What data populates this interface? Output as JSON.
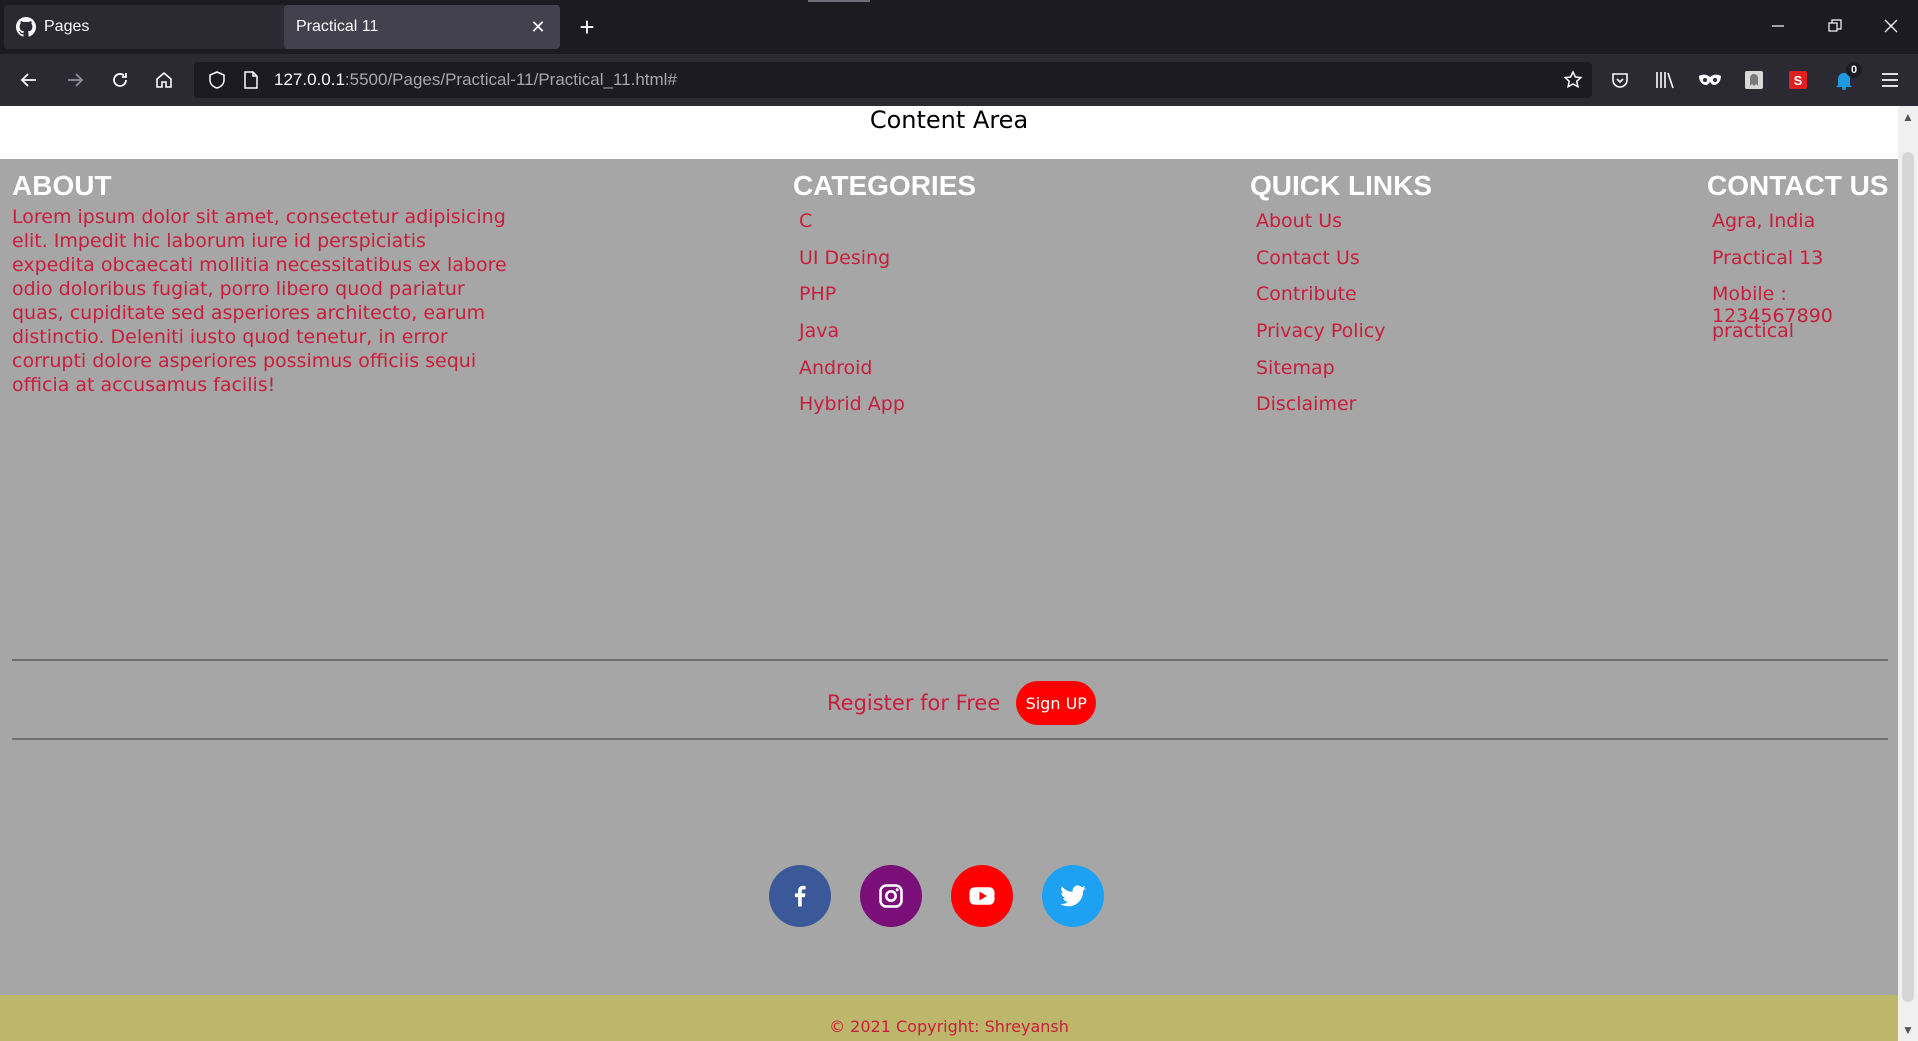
{
  "browser": {
    "tabs": [
      {
        "title": "Pages",
        "icon": "github-icon",
        "active": false
      },
      {
        "title": "Practical 11",
        "icon": "",
        "active": true
      }
    ],
    "url_host": "127.0.0.1",
    "url_rest": ":5500/Pages/Practical-11/Practical_11.html#",
    "extension_badge": "0"
  },
  "page": {
    "content_area_title": "Content Area",
    "about": {
      "heading": "ABOUT",
      "text": "Lorem ipsum dolor sit amet, consectetur adipisicing elit. Impedit hic laborum iure id perspiciatis expedita obcaecati mollitia necessitatibus ex labore odio doloribus fugiat, porro libero quod pariatur quas, cupiditate sed asperiores architecto, earum distinctio. Deleniti iusto quod tenetur, in error corrupti dolore asperiores possimus officiis sequi officia at accusamus facilis!"
    },
    "categories": {
      "heading": "CATEGORIES",
      "items": [
        "C",
        "UI Desing",
        "PHP",
        "Java",
        "Android",
        "Hybrid App"
      ]
    },
    "quick_links": {
      "heading": "QUICK LINKS",
      "items": [
        "About Us",
        "Contact Us",
        "Contribute",
        "Privacy Policy",
        "Sitemap",
        "Disclaimer"
      ]
    },
    "contact": {
      "heading": "CONTACT US",
      "items": [
        "Agra, India",
        "Practical 13",
        "Mobile : 1234567890",
        "practical"
      ]
    },
    "register": {
      "text": "Register for Free",
      "button": "Sign UP"
    },
    "social": [
      {
        "name": "facebook-icon",
        "color": "#3b5998"
      },
      {
        "name": "instagram-icon",
        "color": "#7a0f7a"
      },
      {
        "name": "youtube-icon",
        "color": "#ff0000"
      },
      {
        "name": "twitter-icon",
        "color": "#1da1f2"
      }
    ],
    "copyright": "© 2021 Copyright: Shreyansh"
  },
  "colors": {
    "link": "#c81e3c",
    "footer_bg": "#a6a6a6",
    "copyright_bar": "#bdb76b",
    "signup": "#ff0000"
  }
}
